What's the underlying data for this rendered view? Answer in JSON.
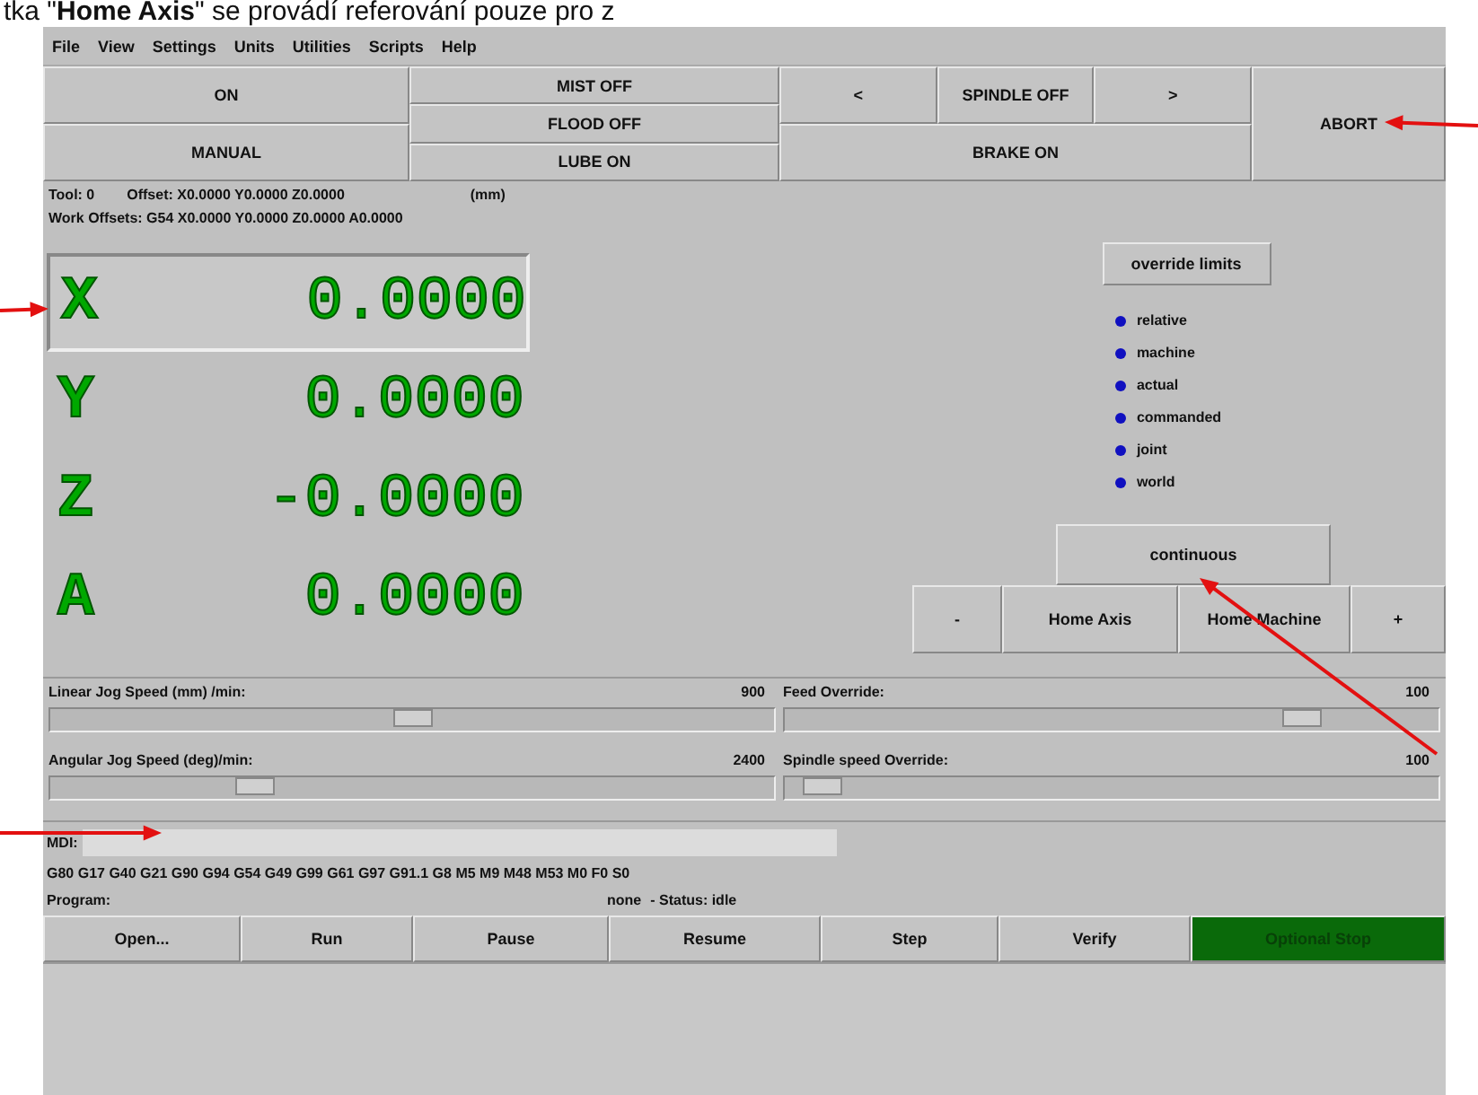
{
  "caption": "tka \"**Home Axis**\" se provádí referování pouze pro z",
  "menu": [
    "File",
    "View",
    "Settings",
    "Units",
    "Utilities",
    "Scripts",
    "Help"
  ],
  "controls": {
    "power": "ON",
    "mode": "MANUAL",
    "mist": "MIST OFF",
    "flood": "FLOOD OFF",
    "lube": "LUBE ON",
    "spindle_left": "<",
    "spindle": "SPINDLE OFF",
    "spindle_right": ">",
    "brake": "BRAKE ON",
    "abort": "ABORT"
  },
  "info": {
    "tool": "Tool:  0",
    "offset": "Offset: X0.0000 Y0.0000 Z0.0000",
    "units": "(mm)",
    "work_offsets": "Work Offsets:   G54 X0.0000 Y0.0000 Z0.0000 A0.0000"
  },
  "axes": [
    {
      "letter": "X",
      "value": "0.0000",
      "selected": true
    },
    {
      "letter": "Y",
      "value": "0.0000",
      "selected": false
    },
    {
      "letter": "Z",
      "value": "-0.0000",
      "selected": false
    },
    {
      "letter": "A",
      "value": "0.0000",
      "selected": false
    }
  ],
  "override_limits": "override limits",
  "coord_modes": [
    "relative",
    "machine",
    "actual",
    "commanded",
    "joint",
    "world"
  ],
  "jog_mode": "continuous",
  "jog_buttons": [
    "-",
    "Home Axis",
    "Home Machine",
    "+"
  ],
  "sliders": [
    {
      "label": "Linear Jog Speed    (mm) /min:",
      "reading": "900",
      "level": 0.5
    },
    {
      "label": "Feed Override:",
      "reading": "100",
      "level": 0.81
    },
    {
      "label": "Angular Jog Speed (deg)/min:",
      "reading": "2400",
      "level": 0.27
    },
    {
      "label": "Spindle speed Override:",
      "reading": "100",
      "level": 0.03
    }
  ],
  "mdi_label": "MDI:",
  "gcodes": "G80 G17 G40 G21 G90 G94 G54 G49 G99 G61 G97 G91.1 G8 M5 M9 M48 M53 M0 F0 S0",
  "program": {
    "label": "Program:",
    "file": "none",
    "status": "-  Status:  idle"
  },
  "actions": [
    {
      "label": "Open...",
      "on": false
    },
    {
      "label": "Run",
      "on": false
    },
    {
      "label": "Pause",
      "on": false
    },
    {
      "label": "Resume",
      "on": false
    },
    {
      "label": "Step",
      "on": false
    },
    {
      "label": "Verify",
      "on": false
    },
    {
      "label": "Optional Stop",
      "on": true
    }
  ]
}
